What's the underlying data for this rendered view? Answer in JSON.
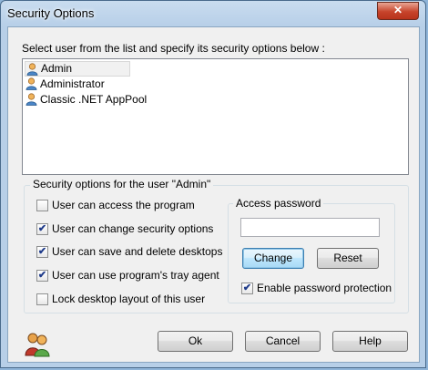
{
  "window": {
    "title": "Security Options",
    "close_glyph": "✕"
  },
  "users": {
    "instruction": "Select user from the list and specify its security options below :",
    "items": [
      {
        "name": "Admin",
        "selected": true
      },
      {
        "name": "Administrator",
        "selected": false
      },
      {
        "name": "Classic .NET AppPool",
        "selected": false
      }
    ]
  },
  "options": {
    "group_title": "Security options for the user \"Admin\"",
    "items": [
      {
        "label": "User can access the program",
        "checked": false
      },
      {
        "label": "User can change security options",
        "checked": true
      },
      {
        "label": "User can save and delete desktops",
        "checked": true
      },
      {
        "label": "User can use program's tray agent",
        "checked": true
      },
      {
        "label": "Lock desktop layout of this user",
        "checked": false
      }
    ]
  },
  "password": {
    "group_title": "Access password",
    "value": "",
    "change_label": "Change",
    "reset_label": "Reset",
    "protection_label": "Enable password protection",
    "protection_checked": true
  },
  "footer": {
    "ok_label": "Ok",
    "cancel_label": "Cancel",
    "help_label": "Help"
  },
  "check_glyph": "✔"
}
